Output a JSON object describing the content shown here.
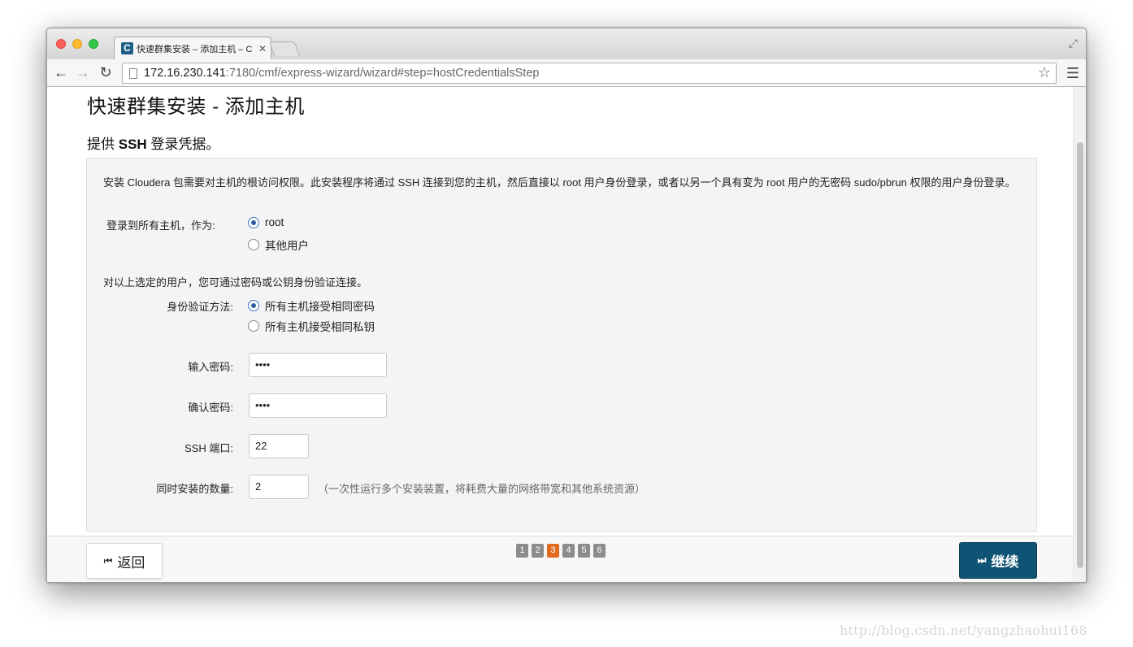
{
  "browser": {
    "tab_title": "快速群集安装 – 添加主机 – C",
    "tab_favicon": "C",
    "url_host": "172.16.230.141",
    "url_path": ":7180/cmf/express-wizard/wizard#step=hostCredentialsStep",
    "icons": {
      "back": "arrow-left-icon",
      "forward": "arrow-right-icon",
      "reload": "reload-icon",
      "star": "star-icon",
      "menu": "hamburger-menu-icon"
    }
  },
  "page": {
    "title": "快速群集安装 - 添加主机",
    "section_title_prefix": "提供 ",
    "section_title_bold": "SSH",
    "section_title_suffix": " 登录凭据。",
    "intro": "安装 Cloudera 包需要对主机的根访问权限。此安装程序将通过 SSH 连接到您的主机，然后直接以 root 用户身份登录，或者以另一个具有变为 root 用户的无密码 sudo/pbrun 权限的用户身份登录。",
    "login_label": "登录到所有主机，作为:",
    "login_options": [
      {
        "label": "root",
        "checked": true
      },
      {
        "label": "其他用户",
        "checked": false
      }
    ],
    "auth_note": "对以上选定的用户，您可通过密码或公钥身份验证连接。",
    "auth_label": "身份验证方法:",
    "auth_options": [
      {
        "label": "所有主机接受相同密码",
        "checked": true
      },
      {
        "label": "所有主机接受相同私钥",
        "checked": false
      }
    ],
    "password_label": "输入密码:",
    "password_value": "••••",
    "confirm_label": "确认密码:",
    "confirm_value": "••••",
    "ssh_port_label": "SSH 端口:",
    "ssh_port_value": "22",
    "parallel_label": "同时安装的数量:",
    "parallel_value": "2",
    "parallel_hint": "（一次性运行多个安装装置，将耗费大量的网络带宽和其他系统资源）"
  },
  "footer": {
    "back_label": "返回",
    "next_label": "继续",
    "steps": [
      "1",
      "2",
      "3",
      "4",
      "5",
      "6"
    ],
    "active_step": "3",
    "colors": {
      "next_button": "#0f5375",
      "active_step": "#e06b1e",
      "step": "#8c8c8c"
    }
  },
  "watermark": "http://blog.csdn.net/yangzhaohui168"
}
